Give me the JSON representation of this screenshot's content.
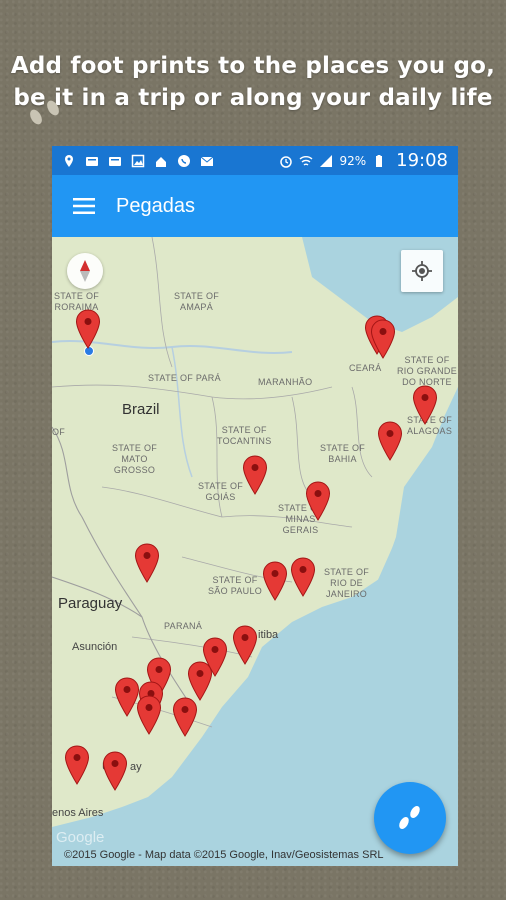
{
  "caption": {
    "line1": "Add foot prints to the places you go,",
    "line2": "be it in a trip or along your daily life"
  },
  "status_bar": {
    "battery": "92%",
    "time": "19:08",
    "icons": [
      "location-icon",
      "voicemail-icon",
      "voicemail-icon",
      "gallery-icon",
      "sync-icon",
      "whatsapp-icon",
      "mail-icon",
      "alarm-icon",
      "wifi-icon",
      "signal-icon",
      "battery-icon"
    ]
  },
  "toolbar": {
    "title": "Pegadas",
    "menu_icon": "hamburger-menu-icon"
  },
  "map": {
    "country_labels": [
      "Brazil",
      "Paraguay"
    ],
    "state_labels": [
      "STATE OF\nRORAIMA",
      "STATE OF\nAMAPÁ",
      "STATE OF PARÁ",
      "MARANHÃO",
      "CEARÁ",
      "STATE OF\nRIO GRANDE\nDO NORTE",
      "STATE OF\nALAGOAS",
      "STATE OF\nTOCANTINS",
      "STATE OF\nBAHIA",
      "STATE OF\nMATO\nGROSSO",
      "STATE OF\nGOIÁS",
      "STATE OF\nMINAS\nGERAIS",
      "STATE OF\nSÃO PAULO",
      "STATE OF\nRIO DE\nJANEIRO",
      "PARANÁ",
      "OF"
    ],
    "city_labels": [
      "Asunción",
      "itiba",
      "Ur",
      "ay",
      "enos Aires"
    ],
    "attribution": "©2015 Google - Map data ©2015 Google, Inav/Geosistemas SRL",
    "google_logo": "Google",
    "marker_count": 20
  },
  "colors": {
    "status_bar": "#1976d2",
    "toolbar": "#2196f3",
    "fab": "#2196f3",
    "marker": "#e53935",
    "water": "#aad3df",
    "land": "#dfe8c9"
  },
  "fab": {
    "icon": "footprints-icon"
  }
}
